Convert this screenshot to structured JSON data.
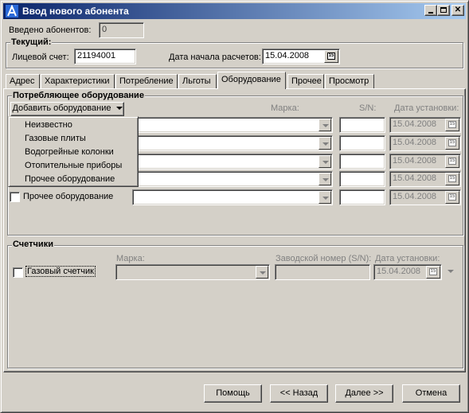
{
  "window": {
    "title": "Ввод нового абонента"
  },
  "header": {
    "entered_label": "Введено абонентов:",
    "entered_value": "0",
    "current_group": "Текущий:",
    "account_label": "Лицевой счет:",
    "account_value": "21194001",
    "start_date_label": "Дата начала расчетов:",
    "start_date_value": "15.04.2008"
  },
  "tabs": [
    {
      "label": "Адрес"
    },
    {
      "label": "Характеристики"
    },
    {
      "label": "Потребление"
    },
    {
      "label": "Льготы"
    },
    {
      "label": "Оборудование"
    },
    {
      "label": "Прочее"
    },
    {
      "label": "Просмотр"
    }
  ],
  "equipment": {
    "group_title": "Потребляющее оборудование",
    "add_button": "Добавить оборудование",
    "col_brand": "Марка:",
    "col_sn": "S/N:",
    "col_install_date": "Дата установки:",
    "rows": [
      {
        "label": "",
        "date": "15.04.2008"
      },
      {
        "label": "",
        "date": "15.04.2008"
      },
      {
        "label": "",
        "date": "15.04.2008"
      },
      {
        "label": "",
        "date": "15.04.2008"
      },
      {
        "label": "Прочее оборудование",
        "date": "15.04.2008"
      }
    ],
    "menu": [
      "Неизвестно",
      "Газовые плиты",
      "Водогрейные колонки",
      "Отопительные приборы",
      "Прочее оборудование"
    ]
  },
  "meters": {
    "group_title": "Счетчики",
    "gas_meter_label": "Газовый счетчик",
    "brand_label": "Марка:",
    "serial_label": "Заводской номер (S/N):",
    "install_date_label": "Дата установки:",
    "install_date_value": "15.04.2008"
  },
  "footer": {
    "help": "Помощь",
    "back": "<< Назад",
    "next": "Далее >>",
    "cancel": "Отмена"
  },
  "colors": {
    "title_start": "#0a246a",
    "title_end": "#a6caf0",
    "face": "#d4d0c8"
  }
}
